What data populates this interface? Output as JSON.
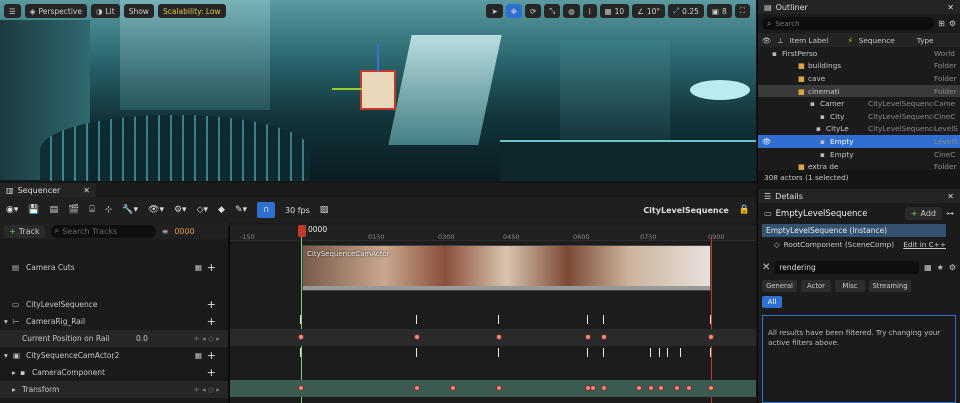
{
  "viewport": {
    "perspective_label": "Perspective",
    "lit_label": "Lit",
    "show_label": "Show",
    "scalability_label": "Scalability: Low",
    "grid_snap_value": "10",
    "rotation_snap_value": "10°",
    "scale_snap_value": "0.25",
    "camera_speed_value": "8"
  },
  "outliner": {
    "tab_label": "Outliner",
    "search_placeholder": "Search",
    "col_item_label": "Item Label",
    "col_sequence": "Sequence",
    "col_type": "Type",
    "rows": [
      {
        "label": "FirstPerso",
        "sequence": "",
        "type": "World"
      },
      {
        "label": "buildings",
        "sequence": "",
        "type": "Folder"
      },
      {
        "label": "cave",
        "sequence": "",
        "type": "Folder"
      },
      {
        "label": "cinemati",
        "sequence": "",
        "type": "Folder"
      },
      {
        "label": "Camer",
        "sequence": "CityLevelSequence",
        "type": "Came"
      },
      {
        "label": "City",
        "sequence": "CityLevelSequence",
        "type": "CineC"
      },
      {
        "label": "CityLe",
        "sequence": "CityLevelSequence",
        "type": "LevelS"
      },
      {
        "label": "Empty",
        "sequence": "",
        "type": "LevelS"
      },
      {
        "label": "Empty",
        "sequence": "",
        "type": "CineC"
      },
      {
        "label": "extra de",
        "sequence": "",
        "type": "Folder"
      }
    ],
    "status": "308 actors (1 selected)"
  },
  "sequencer": {
    "tab_label": "Sequencer",
    "fps_label": "30 fps",
    "sequence_name": "CityLevelSequence",
    "track_button": "Track",
    "search_placeholder": "Search Tracks",
    "current_frame": "0000",
    "playhead_frame": "0000",
    "ruler_ticks": [
      "-150",
      "0150",
      "0300",
      "0450",
      "0600",
      "0750",
      "0900"
    ],
    "shot_label": "CitySequenceCamActor",
    "tracks": [
      {
        "label": "Camera Cuts"
      },
      {
        "label": "CityLevelSequence"
      },
      {
        "label": "CameraRig_Rail"
      },
      {
        "label": "Current Position on Rail",
        "value": "0.0"
      },
      {
        "label": "CitySequenceCamActor2"
      },
      {
        "label": "CameraComponent"
      },
      {
        "label": "Transform"
      }
    ]
  },
  "details": {
    "tab_label": "Details",
    "object_name": "EmptyLevelSequence",
    "add_button": "Add",
    "instance_label": "EmptyLevelSequence (Instance)",
    "root_component": "RootComponent (SceneComp)",
    "edit_cpp": "Edit in C++",
    "search_value": "rendering",
    "filter_tabs": [
      "General",
      "Actor",
      "Misc",
      "Streaming"
    ],
    "filter_all": "All",
    "filtered_message": "All results have been filtered. Try changing your active filters above."
  }
}
